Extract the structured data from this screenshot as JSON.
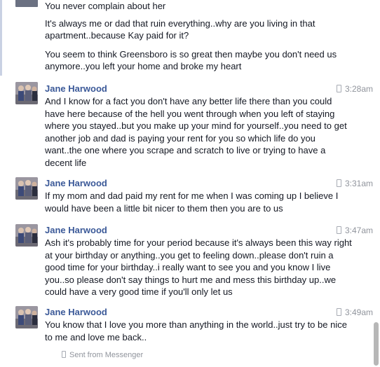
{
  "thread": {
    "continuation": [
      "You never complain about her",
      "It's always me or dad that ruin everything..why are you living in that apartment..because Kay paid for it?",
      "You seem to think Greensboro is so great then maybe you don't need us anymore..you left your home and broke my heart"
    ],
    "messages": [
      {
        "sender": "Jane Harwood",
        "time": "3:28am",
        "text": "And I know for a fact you don't have any better life there than you could have here because of the hell you went through when you left of staying where you stayed..but you make up your mind for yourself..you need to get another job and dad is paying your rent for you so which life do you want..the one where you scrape and scratch to live or trying to have a decent life"
      },
      {
        "sender": "Jane Harwood",
        "time": "3:31am",
        "text": "If my mom and dad paid my rent for me when I was coming up I believe I would have been a little bit nicer to them then you are to us"
      },
      {
        "sender": "Jane Harwood",
        "time": "3:47am",
        "text": "Ash it's probably time for your period because it's always been this way right at your birthday or anything..you get to feeling down..please don't ruin a good time for your birthday..i really want to see you and you know I live you..so please don't say things to hurt me and mess this birthday up..we could have a very good time if you'll only let us"
      },
      {
        "sender": "Jane Harwood",
        "time": "3:49am",
        "text": "You know that I love you more than anything in the world..just try to be nice to me and love me back.."
      }
    ],
    "sent_from": "Sent from Messenger"
  }
}
